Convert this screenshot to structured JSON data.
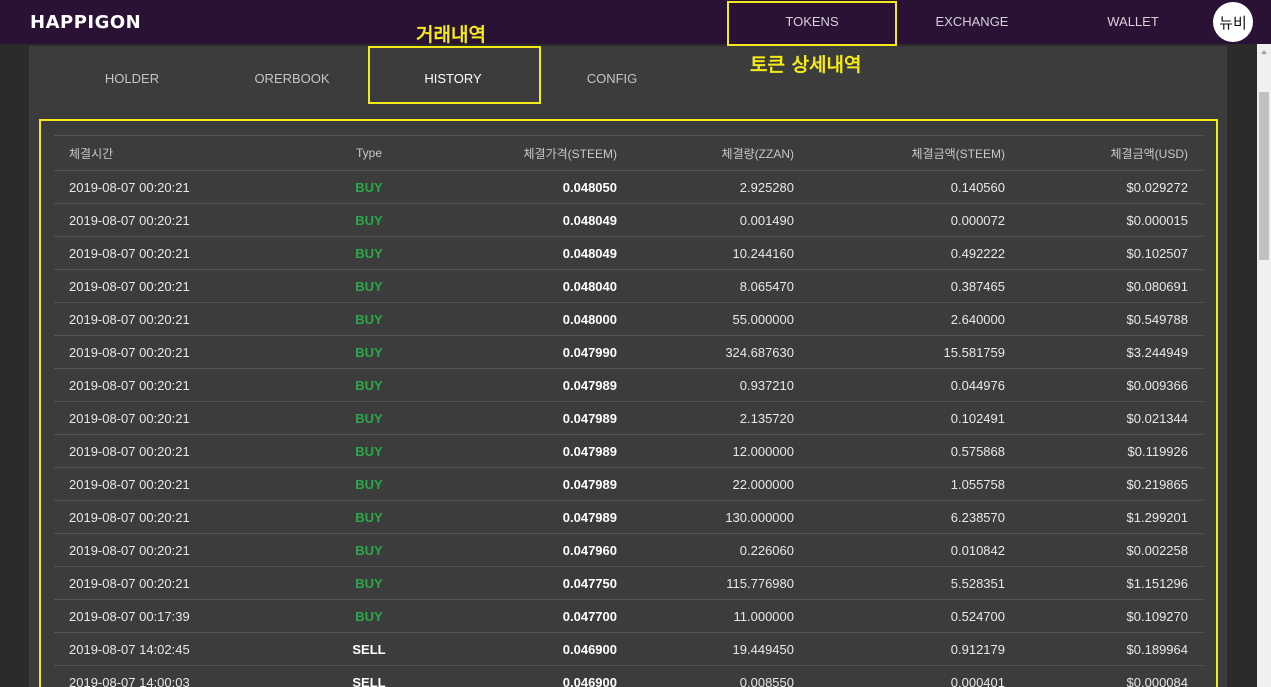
{
  "app": {
    "logo": "HAPPIGON",
    "nav": [
      {
        "label": "TOKENS"
      },
      {
        "label": "EXCHANGE"
      },
      {
        "label": "WALLET"
      }
    ],
    "avatar_text": "뉴비"
  },
  "annotations": {
    "history": "거래내역",
    "tokens": "토큰 상세내역",
    "color": "#f5ea19"
  },
  "tabs": [
    {
      "label": "HOLDER"
    },
    {
      "label": "ORERBOOK"
    },
    {
      "label": "HISTORY"
    },
    {
      "label": "CONFIG"
    }
  ],
  "table": {
    "headers": [
      "체결시간",
      "Type",
      "체결가격(STEEM)",
      "체결량(ZZAN)",
      "체결금액(STEEM)",
      "체결금액(USD)"
    ],
    "rows": [
      [
        "2019-08-07 00:20:21",
        "BUY",
        "0.048050",
        "2.925280",
        "0.140560",
        "$0.029272"
      ],
      [
        "2019-08-07 00:20:21",
        "BUY",
        "0.048049",
        "0.001490",
        "0.000072",
        "$0.000015"
      ],
      [
        "2019-08-07 00:20:21",
        "BUY",
        "0.048049",
        "10.244160",
        "0.492222",
        "$0.102507"
      ],
      [
        "2019-08-07 00:20:21",
        "BUY",
        "0.048040",
        "8.065470",
        "0.387465",
        "$0.080691"
      ],
      [
        "2019-08-07 00:20:21",
        "BUY",
        "0.048000",
        "55.000000",
        "2.640000",
        "$0.549788"
      ],
      [
        "2019-08-07 00:20:21",
        "BUY",
        "0.047990",
        "324.687630",
        "15.581759",
        "$3.244949"
      ],
      [
        "2019-08-07 00:20:21",
        "BUY",
        "0.047989",
        "0.937210",
        "0.044976",
        "$0.009366"
      ],
      [
        "2019-08-07 00:20:21",
        "BUY",
        "0.047989",
        "2.135720",
        "0.102491",
        "$0.021344"
      ],
      [
        "2019-08-07 00:20:21",
        "BUY",
        "0.047989",
        "12.000000",
        "0.575868",
        "$0.119926"
      ],
      [
        "2019-08-07 00:20:21",
        "BUY",
        "0.047989",
        "22.000000",
        "1.055758",
        "$0.219865"
      ],
      [
        "2019-08-07 00:20:21",
        "BUY",
        "0.047989",
        "130.000000",
        "6.238570",
        "$1.299201"
      ],
      [
        "2019-08-07 00:20:21",
        "BUY",
        "0.047960",
        "0.226060",
        "0.010842",
        "$0.002258"
      ],
      [
        "2019-08-07 00:20:21",
        "BUY",
        "0.047750",
        "115.776980",
        "5.528351",
        "$1.151296"
      ],
      [
        "2019-08-07 00:17:39",
        "BUY",
        "0.047700",
        "11.000000",
        "0.524700",
        "$0.109270"
      ],
      [
        "2019-08-07 14:02:45",
        "SELL",
        "0.046900",
        "19.449450",
        "0.912179",
        "$0.189964"
      ],
      [
        "2019-08-07 14:00:03",
        "SELL",
        "0.046900",
        "0.008550",
        "0.000401",
        "$0.000084"
      ]
    ]
  },
  "colors": {
    "header_bg": "#2a1234",
    "buy": "#2ba84a",
    "sell": "#ffffff"
  }
}
